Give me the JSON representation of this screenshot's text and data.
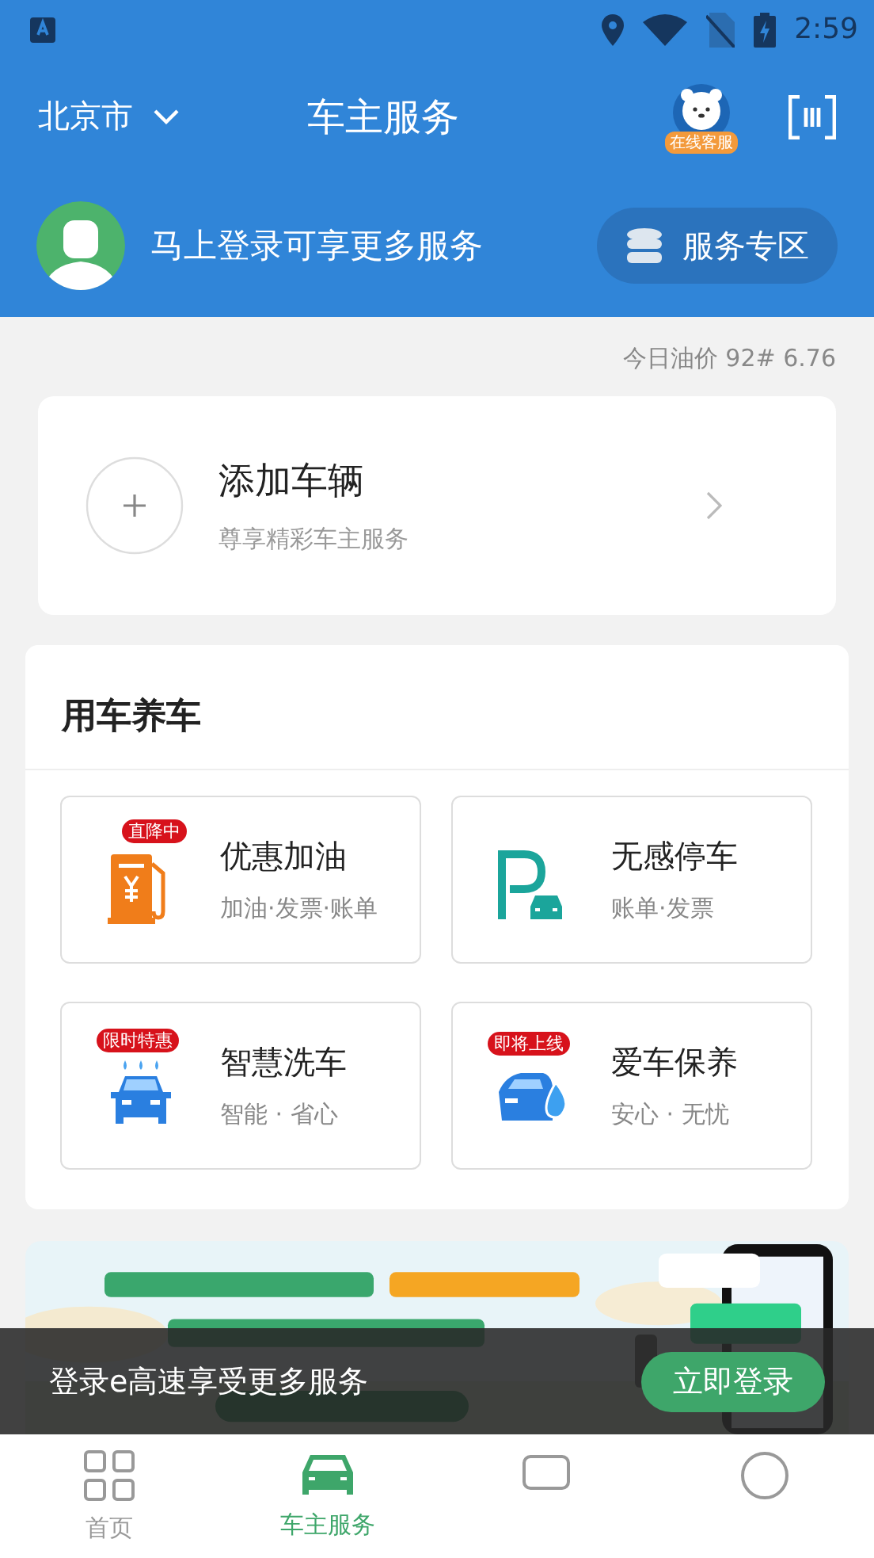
{
  "status_bar": {
    "time": "2:59"
  },
  "header": {
    "city": "北京市",
    "title": "车主服务",
    "support_badge": "在线客服"
  },
  "login_bar": {
    "prompt": "马上登录可享更多服务",
    "zone_button": "服务专区"
  },
  "oil_price": "今日油价 92# 6.76",
  "add_vehicle": {
    "title": "添加车辆",
    "subtitle": "尊享精彩车主服务"
  },
  "section": {
    "title": "用车养车",
    "services": [
      {
        "kind": "fuel",
        "title": "优惠加油",
        "subtitle": "加油·发票·账单",
        "badge": "直降中"
      },
      {
        "kind": "parking",
        "title": "无感停车",
        "subtitle": "账单·发票"
      },
      {
        "kind": "wash",
        "title": "智慧洗车",
        "subtitle": "智能 · 省心",
        "badge": "限时特惠"
      },
      {
        "kind": "care",
        "title": "爱车保养",
        "subtitle": "安心 · 无忧",
        "badge": "即将上线"
      }
    ]
  },
  "toast": {
    "message": "登录e高速享受更多服务",
    "button": "立即登录"
  },
  "bottom_nav": [
    {
      "kind": "grid",
      "label": "首页",
      "selected": false
    },
    {
      "kind": "car",
      "label": "车主服务",
      "selected": true
    },
    {
      "kind": "chat",
      "selected": false
    },
    {
      "kind": "person",
      "selected": false
    }
  ]
}
